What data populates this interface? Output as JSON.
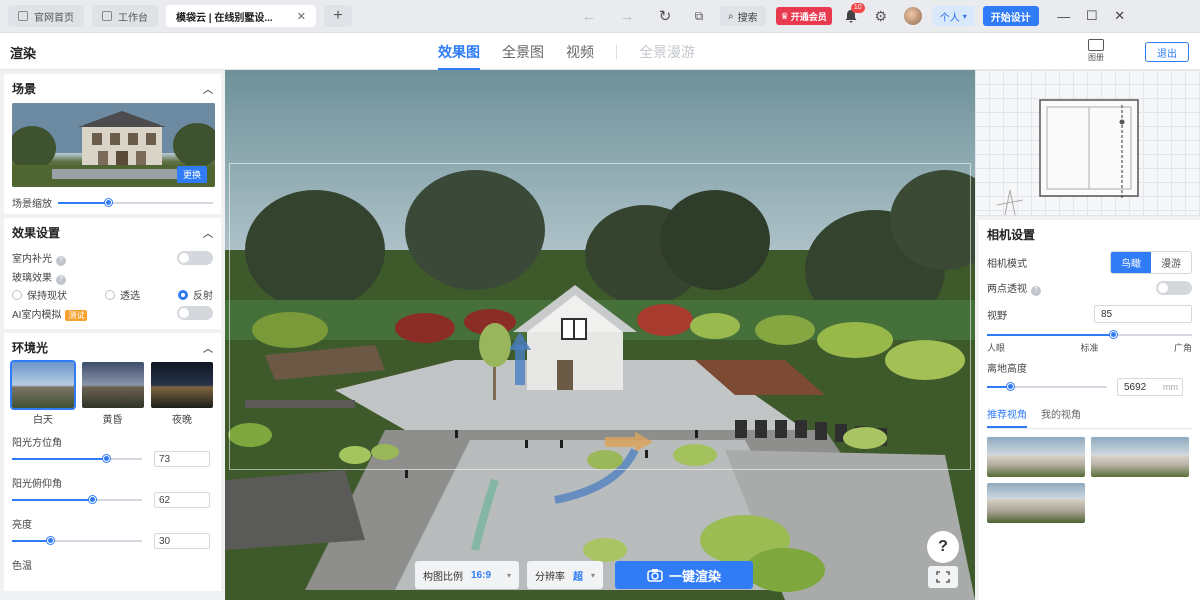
{
  "titlebar": {
    "tabs": [
      {
        "label": "官网首页",
        "icon": "home-icon"
      },
      {
        "label": "工作台",
        "icon": "desktop-icon"
      },
      {
        "label": "模袋云 | 在线别墅设...",
        "icon": "close-icon"
      }
    ],
    "search_label": "搜索",
    "vip_label": "开通会员",
    "notification_count": "10",
    "personal_label": "个人",
    "start_design_label": "开始设计"
  },
  "header": {
    "title": "渲染",
    "modes": [
      "效果图",
      "全景图",
      "视频",
      "全景漫游"
    ],
    "active_mode": "效果图",
    "album_label": "图册",
    "exit_label": "退出"
  },
  "left_panel": {
    "scene": {
      "title": "场景",
      "change_label": "更换",
      "scale_label": "场景缩放",
      "scale_value": 0.33
    },
    "effects": {
      "title": "效果设置",
      "indoor_light_label": "室内补光",
      "glass_label": "玻璃效果",
      "glass_options": [
        "保持现状",
        "透选",
        "反射"
      ],
      "glass_selected": "反射",
      "ai_label": "AI室内模拟",
      "ai_badge": "测试"
    },
    "ambient": {
      "title": "环境光",
      "presets": [
        "白天",
        "黄昏",
        "夜晚"
      ],
      "selected": "白天",
      "params": [
        {
          "label": "阳光方位角",
          "value": "73",
          "fraction": 0.73
        },
        {
          "label": "阳光俯仰角",
          "value": "62",
          "fraction": 0.62
        },
        {
          "label": "亮度",
          "value": "30",
          "fraction": 0.3
        }
      ],
      "color_temp_label": "色温"
    }
  },
  "viewport": {
    "ratio_label": "构图比例",
    "ratio_value": "16:9",
    "resolution_label": "分辨率",
    "resolution_value": "超",
    "render_label": "一键渲染",
    "help_label": "?"
  },
  "right_panel": {
    "camera_title": "相机设置",
    "camera_mode_label": "相机模式",
    "camera_modes": [
      "鸟瞰",
      "漫游"
    ],
    "camera_mode_selected": "鸟瞰",
    "two_point_label": "两点透视",
    "fov_label": "视野",
    "fov_value": "85",
    "fov_fraction": 0.62,
    "fov_ticks": [
      "人眼",
      "标准",
      "广角"
    ],
    "height_label": "离地高度",
    "height_value": "5692",
    "height_unit": "mm",
    "height_fraction": 0.2,
    "view_tabs": [
      "推荐视角",
      "我的视角"
    ],
    "view_tab_selected": "推荐视角"
  },
  "colors": {
    "accent": "#2f7cf6",
    "vip": "#e9394f",
    "test_badge": "#f7a230"
  }
}
